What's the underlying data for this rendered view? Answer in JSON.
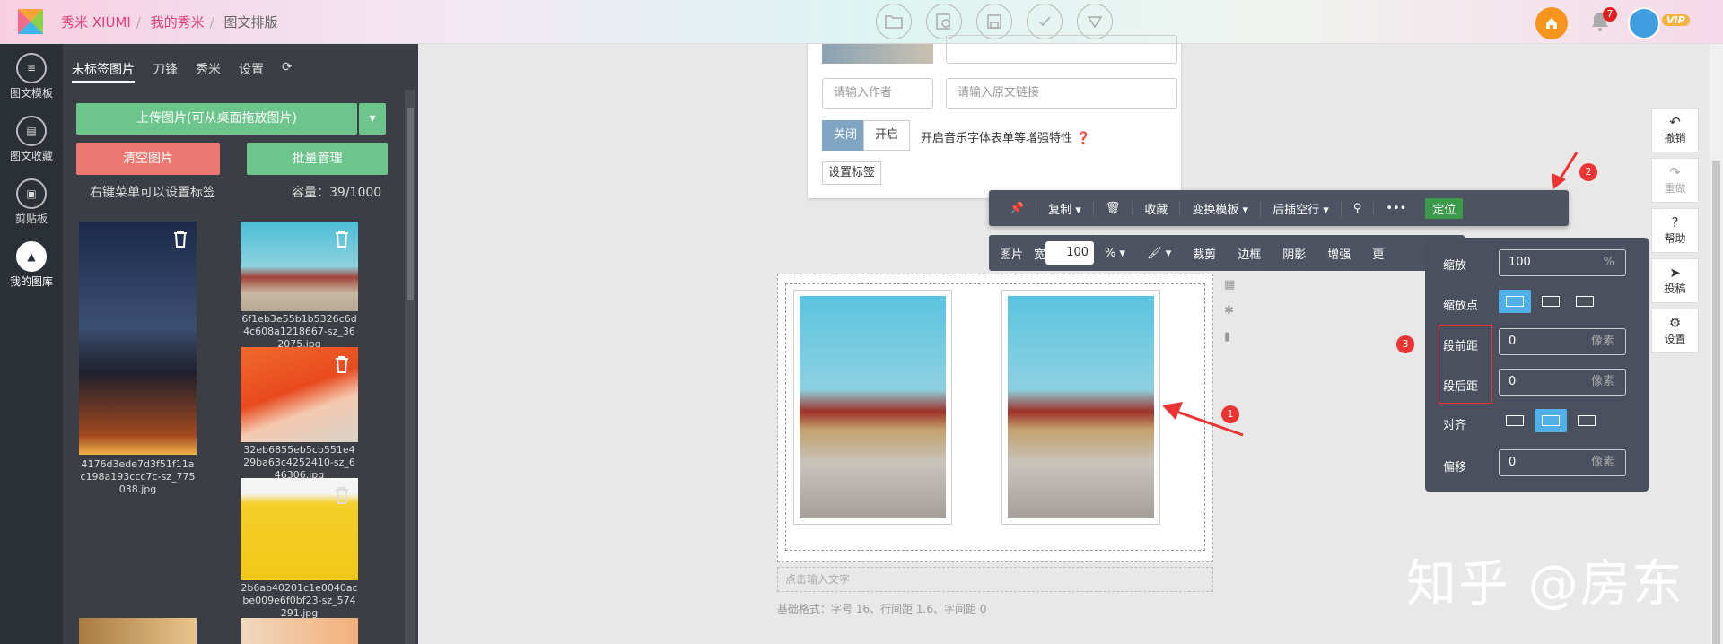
{
  "header": {
    "brand": "秀米 XIUMI",
    "crumbs": [
      "我的秀米",
      "图文排版"
    ],
    "toolbar_icons": [
      "folder-icon",
      "preview-icon",
      "save-icon",
      "check-icon",
      "download-icon"
    ],
    "notification_count": "7",
    "vip": "VIP"
  },
  "leftnav": [
    {
      "label": "图文模板",
      "icon": "template-icon"
    },
    {
      "label": "图文收藏",
      "icon": "favorite-icon"
    },
    {
      "label": "剪贴板",
      "icon": "clipboard-icon"
    },
    {
      "label": "我的图库",
      "icon": "gallery-icon",
      "active": true
    }
  ],
  "panel": {
    "tabs": [
      "未标签图片",
      "刀锋",
      "秀米",
      "设置"
    ],
    "upload_label": "上传图片(可从桌面拖放图片)",
    "clear_label": "清空图片",
    "batch_label": "批量管理",
    "hint": "右键菜单可以设置标签",
    "capacity": "容量：39/1000",
    "images": [
      {
        "name": "4176d3ede7d3f51f11ac198a193ccc7c-sz_775038.jpg"
      },
      {
        "name": "6f1eb3e55b1b5326c6d4c608a1218667-sz_362075.jpg"
      },
      {
        "name": "32eb6855eb5cb551e429ba63c4252410-sz_646306.jpg"
      },
      {
        "name": "2b6ab40201c1e0040acbe009e6f0bf23-sz_574291.jpg"
      }
    ]
  },
  "form": {
    "author_placeholder": "请输入作者",
    "link_placeholder": "请输入原文链接",
    "toggle_off": "关闭",
    "toggle_on": "开启",
    "toggle_desc": "开启音乐字体表单等增强特性",
    "tag_button": "设置标签"
  },
  "toolbar1": {
    "copy": "复制",
    "collect": "收藏",
    "switch_template": "变换模板",
    "insert_line": "后插空行",
    "locate": "定位"
  },
  "toolbar2": {
    "image": "图片",
    "width_label": "宽",
    "width_value": "100",
    "unit": "%",
    "crop": "裁剪",
    "border": "边框",
    "shadow": "阴影",
    "enhance": "增强",
    "more": "更"
  },
  "canvas": {
    "text_placeholder": "点击输入文字",
    "base_format": "基础格式：字号 16、行间距 1.6、字间距 0"
  },
  "popup": {
    "scale_label": "缩放",
    "scale_value": "100",
    "scale_unit": "%",
    "anchor_label": "缩放点",
    "margin_before_label": "段前距",
    "margin_before_value": "0",
    "margin_after_label": "段后距",
    "margin_after_value": "0",
    "px_unit": "像素",
    "align_label": "对齐",
    "offset_label": "偏移",
    "offset_value": "0"
  },
  "markers": [
    "1",
    "2",
    "3"
  ],
  "rightbar": [
    {
      "label": "撤销",
      "icon": "undo-icon"
    },
    {
      "label": "重做",
      "icon": "redo-icon"
    },
    {
      "label": "帮助",
      "icon": "help-icon"
    },
    {
      "label": "投稿",
      "icon": "send-icon"
    },
    {
      "label": "设置",
      "icon": "settings-icon"
    }
  ],
  "watermark": "知乎 @房东",
  "colors": {
    "accent": "#6cc68b",
    "danger": "#ee7872",
    "toolbar": "#4d5361",
    "brand_pink": "#e0407a"
  }
}
